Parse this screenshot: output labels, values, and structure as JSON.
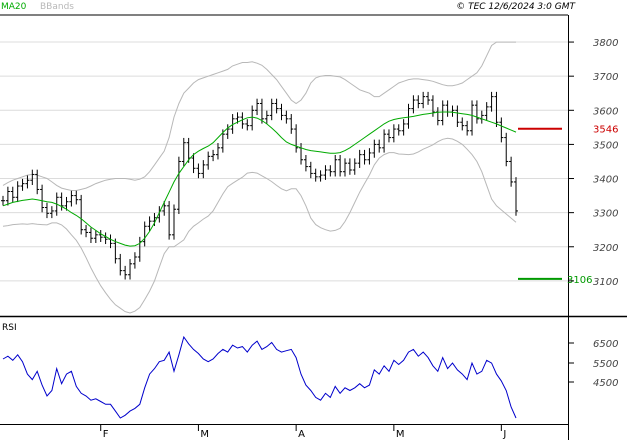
{
  "header": {
    "ma_label": "MA20",
    "bb_label": "BBands",
    "source": "© TEC 12/6/2024 3:0 GMT"
  },
  "colors": {
    "ma": "#00aa00",
    "bands": "#b8b8b8",
    "price": "#000000",
    "rsi": "#0000cc",
    "resistance": "#cc0000",
    "support": "#009900",
    "grid": "#dcdcdc"
  },
  "chart_data": [
    {
      "type": "line",
      "name": "price",
      "y_ticks": [
        "3800",
        "3700",
        "3600",
        "3500",
        "3400",
        "3300",
        "3200",
        "3100"
      ],
      "ylim": [
        3000,
        3850
      ],
      "x_ticks": [
        {
          "label": "F",
          "i": 20
        },
        {
          "label": "M",
          "i": 40
        },
        {
          "label": "A",
          "i": 60
        },
        {
          "label": "M",
          "i": 80
        },
        {
          "label": "J",
          "i": 102
        }
      ],
      "close": [
        3335,
        3362,
        3345,
        3378,
        3385,
        3395,
        3412,
        3368,
        3315,
        3298,
        3305,
        3345,
        3320,
        3332,
        3350,
        3338,
        3250,
        3242,
        3225,
        3235,
        3228,
        3222,
        3210,
        3165,
        3130,
        3118,
        3150,
        3170,
        3215,
        3260,
        3275,
        3285,
        3305,
        3320,
        3235,
        3310,
        3450,
        3505,
        3460,
        3430,
        3415,
        3440,
        3465,
        3470,
        3490,
        3530,
        3545,
        3575,
        3580,
        3560,
        3555,
        3600,
        3620,
        3575,
        3585,
        3620,
        3605,
        3585,
        3575,
        3545,
        3490,
        3455,
        3435,
        3415,
        3405,
        3410,
        3425,
        3420,
        3455,
        3420,
        3445,
        3425,
        3445,
        3470,
        3455,
        3475,
        3500,
        3490,
        3530,
        3520,
        3545,
        3540,
        3560,
        3605,
        3630,
        3620,
        3640,
        3630,
        3595,
        3570,
        3615,
        3595,
        3600,
        3565,
        3555,
        3540,
        3615,
        3575,
        3585,
        3610,
        3640,
        3565,
        3520,
        3450,
        3390,
        3305
      ],
      "ma20": [
        3320,
        3325,
        3330,
        3333,
        3336,
        3338,
        3340,
        3338,
        3335,
        3332,
        3330,
        3325,
        3318,
        3310,
        3300,
        3292,
        3282,
        3270,
        3258,
        3248,
        3238,
        3230,
        3222,
        3215,
        3210,
        3205,
        3202,
        3203,
        3210,
        3225,
        3245,
        3270,
        3300,
        3330,
        3360,
        3390,
        3415,
        3435,
        3455,
        3470,
        3480,
        3488,
        3495,
        3505,
        3520,
        3535,
        3548,
        3558,
        3565,
        3572,
        3578,
        3580,
        3577,
        3570,
        3560,
        3548,
        3535,
        3520,
        3507,
        3500,
        3495,
        3490,
        3485,
        3482,
        3480,
        3478,
        3476,
        3474,
        3474,
        3476,
        3482,
        3490,
        3500,
        3510,
        3520,
        3530,
        3540,
        3550,
        3560,
        3568,
        3573,
        3576,
        3578,
        3580,
        3582,
        3585,
        3588,
        3590,
        3592,
        3594,
        3595,
        3595,
        3594,
        3592,
        3590,
        3588,
        3585,
        3580,
        3575,
        3570,
        3565,
        3560,
        3554,
        3548,
        3542,
        3536
      ],
      "bb_upper": [
        3380,
        3388,
        3395,
        3400,
        3405,
        3410,
        3412,
        3410,
        3405,
        3400,
        3390,
        3380,
        3372,
        3368,
        3365,
        3365,
        3368,
        3372,
        3378,
        3385,
        3390,
        3395,
        3398,
        3400,
        3400,
        3400,
        3398,
        3395,
        3398,
        3405,
        3420,
        3440,
        3460,
        3480,
        3520,
        3580,
        3620,
        3650,
        3665,
        3680,
        3690,
        3695,
        3700,
        3705,
        3710,
        3715,
        3720,
        3730,
        3735,
        3740,
        3740,
        3742,
        3738,
        3732,
        3720,
        3705,
        3690,
        3670,
        3650,
        3630,
        3620,
        3630,
        3650,
        3680,
        3695,
        3700,
        3702,
        3702,
        3700,
        3698,
        3690,
        3680,
        3670,
        3660,
        3655,
        3650,
        3640,
        3640,
        3650,
        3660,
        3670,
        3680,
        3685,
        3690,
        3692,
        3692,
        3690,
        3688,
        3685,
        3680,
        3675,
        3672,
        3672,
        3675,
        3680,
        3690,
        3700,
        3710,
        3730,
        3760,
        3790,
        3800,
        3800,
        3800,
        3800,
        3800
      ],
      "bb_lower": [
        3260,
        3262,
        3265,
        3266,
        3267,
        3266,
        3268,
        3266,
        3265,
        3264,
        3270,
        3270,
        3264,
        3252,
        3235,
        3219,
        3196,
        3168,
        3138,
        3111,
        3086,
        3065,
        3046,
        3030,
        3020,
        3010,
        3006,
        3011,
        3022,
        3045,
        3070,
        3100,
        3140,
        3180,
        3200,
        3200,
        3210,
        3220,
        3245,
        3260,
        3270,
        3281,
        3290,
        3305,
        3330,
        3355,
        3376,
        3386,
        3395,
        3404,
        3416,
        3418,
        3416,
        3408,
        3400,
        3391,
        3380,
        3370,
        3364,
        3370,
        3370,
        3350,
        3320,
        3284,
        3265,
        3256,
        3250,
        3246,
        3248,
        3254,
        3274,
        3300,
        3330,
        3360,
        3385,
        3410,
        3440,
        3460,
        3470,
        3476,
        3476,
        3472,
        3471,
        3470,
        3472,
        3478,
        3486,
        3492,
        3499,
        3508,
        3515,
        3518,
        3516,
        3509,
        3500,
        3486,
        3470,
        3450,
        3420,
        3380,
        3340,
        3320,
        3308,
        3296,
        3284,
        3272
      ],
      "resistance": {
        "value": 3546,
        "label": "3546"
      },
      "support": {
        "value": 3106,
        "label": "3106"
      }
    },
    {
      "type": "line",
      "name": "rsi",
      "title": "RSI",
      "y_ticks": [
        "6500",
        "5500",
        "4500"
      ],
      "values": [
        63,
        65,
        62,
        66,
        61,
        52,
        48,
        54,
        44,
        36,
        40,
        56,
        45,
        52,
        54,
        43,
        38,
        36,
        33,
        34,
        32,
        30,
        30,
        25,
        20,
        22,
        25,
        27,
        30,
        42,
        52,
        56,
        61,
        62,
        68,
        54,
        66,
        79,
        74,
        70,
        67,
        63,
        61,
        63,
        67,
        70,
        68,
        73,
        71,
        72,
        68,
        73,
        76,
        70,
        72,
        75,
        70,
        68,
        69,
        70,
        64,
        52,
        44,
        40,
        35,
        33,
        38,
        35,
        43,
        38,
        42,
        40,
        42,
        45,
        42,
        44,
        55,
        52,
        58,
        54,
        62,
        59,
        62,
        68,
        70,
        65,
        68,
        64,
        58,
        54,
        64,
        56,
        60,
        55,
        52,
        48,
        60,
        52,
        54,
        62,
        60,
        52,
        47,
        40,
        28,
        20
      ]
    }
  ]
}
